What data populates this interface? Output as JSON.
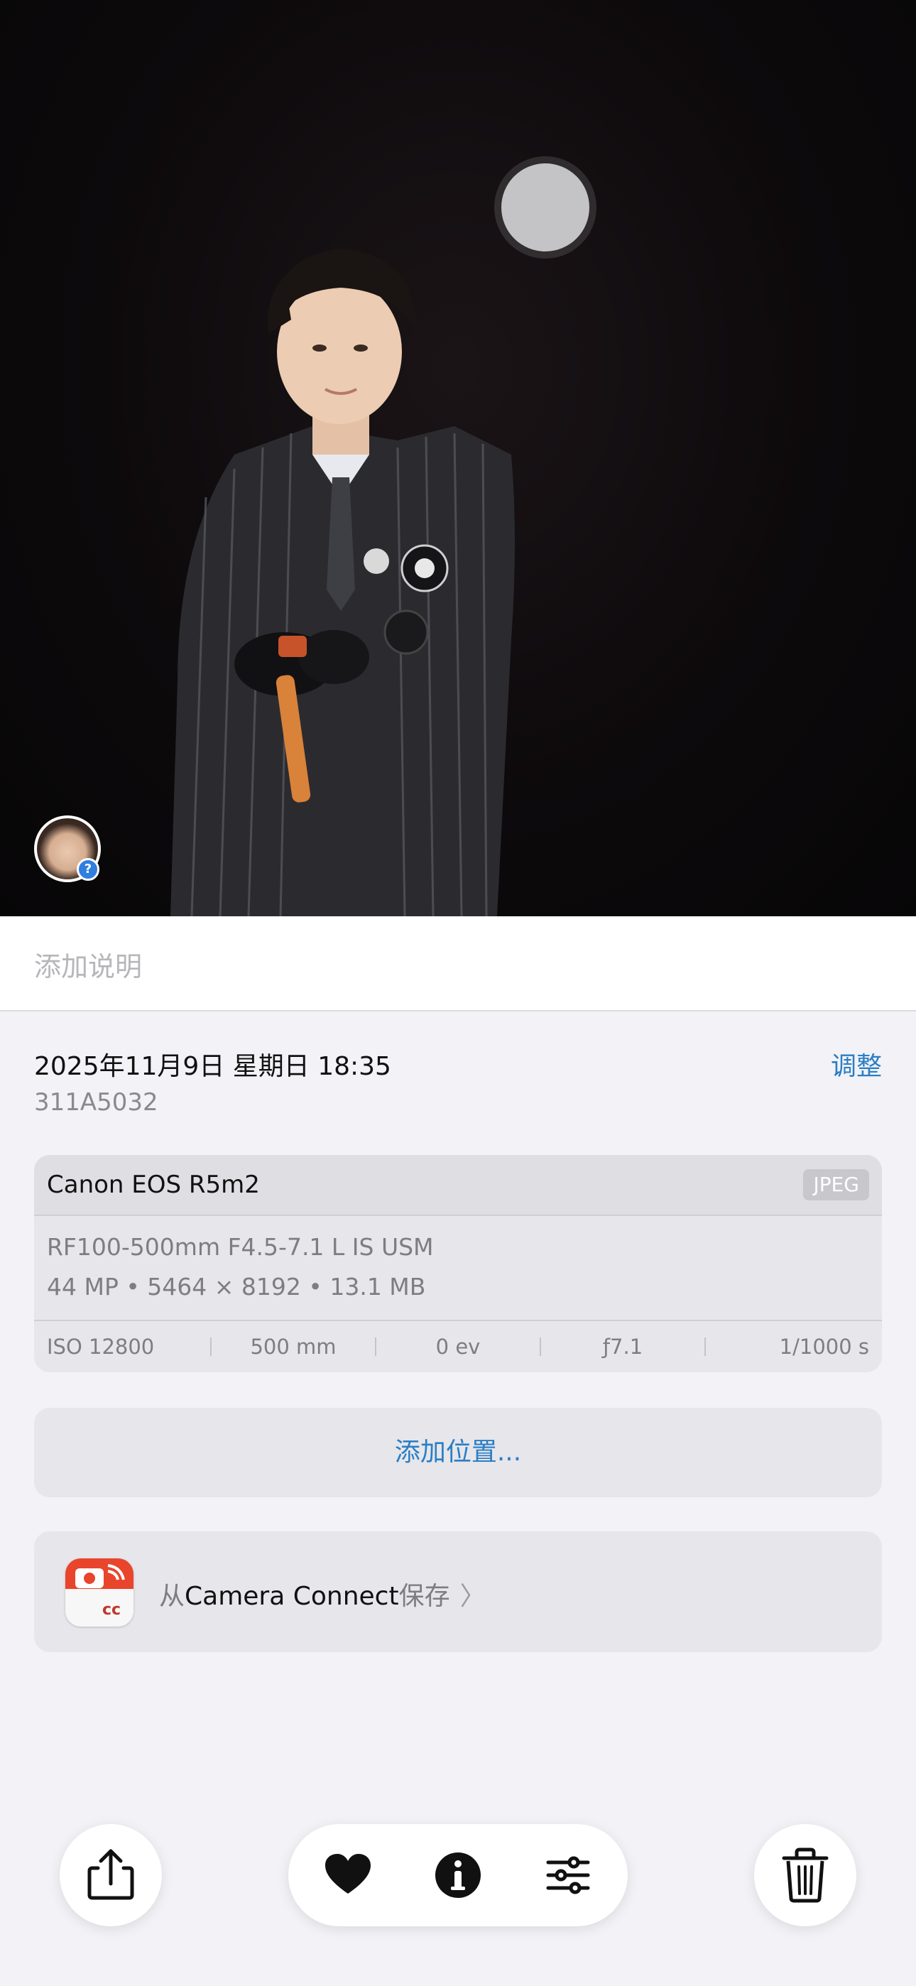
{
  "caption": {
    "placeholder": "添加说明"
  },
  "meta": {
    "datetime": "2025年11月9日 星期日 18:35",
    "adjust_label": "调整",
    "filename": "311A5032"
  },
  "camera": {
    "model": "Canon EOS R5m2",
    "format": "JPEG",
    "lens": "RF100-500mm F4.5-7.1 L IS USM",
    "specs": "44 MP • 5464 × 8192 • 13.1 MB",
    "exif": {
      "iso": "ISO 12800",
      "focal": "500 mm",
      "ev": "0 ev",
      "aperture": "ƒ7.1",
      "shutter": "1/1000 s"
    }
  },
  "location": {
    "label": "添加位置..."
  },
  "app": {
    "from": "从",
    "name": "Camera Connect",
    "save": "保存",
    "chevron": "〉",
    "icon_text": "cc"
  },
  "photo": {
    "people_badge": "?"
  },
  "toolbar": {
    "share_icon": "share-icon",
    "favorite_icon": "heart-icon",
    "info_icon": "info-icon",
    "adjust_icon": "sliders-icon",
    "delete_icon": "trash-icon"
  },
  "colors": {
    "accent": "#2b7ec4",
    "background": "#f2f2f7"
  }
}
